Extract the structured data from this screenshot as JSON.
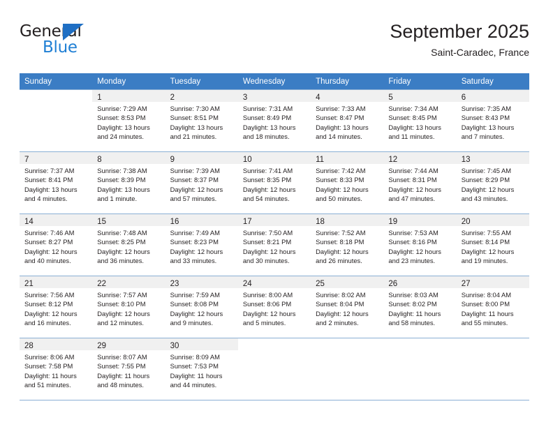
{
  "logo": {
    "word_top": "General",
    "word_bottom": "Blue",
    "color_dark": "#231f20",
    "color_blue": "#1f7fd4",
    "triangle_color": "#1f6fc4"
  },
  "header": {
    "title": "September 2025",
    "subtitle": "Saint-Caradec, France"
  },
  "colors": {
    "header_row_bg": "#3b7dc4",
    "header_row_text": "#ffffff",
    "daynum_bg": "#f0f0f0",
    "grid_line": "#8aafd4",
    "text": "#231f20"
  },
  "weekday_headers": [
    "Sunday",
    "Monday",
    "Tuesday",
    "Wednesday",
    "Thursday",
    "Friday",
    "Saturday"
  ],
  "weeks": [
    [
      {
        "day": "",
        "sunrise": "",
        "sunset": "",
        "daylight_1": "",
        "daylight_2": ""
      },
      {
        "day": "1",
        "sunrise": "Sunrise: 7:29 AM",
        "sunset": "Sunset: 8:53 PM",
        "daylight_1": "Daylight: 13 hours",
        "daylight_2": "and 24 minutes."
      },
      {
        "day": "2",
        "sunrise": "Sunrise: 7:30 AM",
        "sunset": "Sunset: 8:51 PM",
        "daylight_1": "Daylight: 13 hours",
        "daylight_2": "and 21 minutes."
      },
      {
        "day": "3",
        "sunrise": "Sunrise: 7:31 AM",
        "sunset": "Sunset: 8:49 PM",
        "daylight_1": "Daylight: 13 hours",
        "daylight_2": "and 18 minutes."
      },
      {
        "day": "4",
        "sunrise": "Sunrise: 7:33 AM",
        "sunset": "Sunset: 8:47 PM",
        "daylight_1": "Daylight: 13 hours",
        "daylight_2": "and 14 minutes."
      },
      {
        "day": "5",
        "sunrise": "Sunrise: 7:34 AM",
        "sunset": "Sunset: 8:45 PM",
        "daylight_1": "Daylight: 13 hours",
        "daylight_2": "and 11 minutes."
      },
      {
        "day": "6",
        "sunrise": "Sunrise: 7:35 AM",
        "sunset": "Sunset: 8:43 PM",
        "daylight_1": "Daylight: 13 hours",
        "daylight_2": "and 7 minutes."
      }
    ],
    [
      {
        "day": "7",
        "sunrise": "Sunrise: 7:37 AM",
        "sunset": "Sunset: 8:41 PM",
        "daylight_1": "Daylight: 13 hours",
        "daylight_2": "and 4 minutes."
      },
      {
        "day": "8",
        "sunrise": "Sunrise: 7:38 AM",
        "sunset": "Sunset: 8:39 PM",
        "daylight_1": "Daylight: 13 hours",
        "daylight_2": "and 1 minute."
      },
      {
        "day": "9",
        "sunrise": "Sunrise: 7:39 AM",
        "sunset": "Sunset: 8:37 PM",
        "daylight_1": "Daylight: 12 hours",
        "daylight_2": "and 57 minutes."
      },
      {
        "day": "10",
        "sunrise": "Sunrise: 7:41 AM",
        "sunset": "Sunset: 8:35 PM",
        "daylight_1": "Daylight: 12 hours",
        "daylight_2": "and 54 minutes."
      },
      {
        "day": "11",
        "sunrise": "Sunrise: 7:42 AM",
        "sunset": "Sunset: 8:33 PM",
        "daylight_1": "Daylight: 12 hours",
        "daylight_2": "and 50 minutes."
      },
      {
        "day": "12",
        "sunrise": "Sunrise: 7:44 AM",
        "sunset": "Sunset: 8:31 PM",
        "daylight_1": "Daylight: 12 hours",
        "daylight_2": "and 47 minutes."
      },
      {
        "day": "13",
        "sunrise": "Sunrise: 7:45 AM",
        "sunset": "Sunset: 8:29 PM",
        "daylight_1": "Daylight: 12 hours",
        "daylight_2": "and 43 minutes."
      }
    ],
    [
      {
        "day": "14",
        "sunrise": "Sunrise: 7:46 AM",
        "sunset": "Sunset: 8:27 PM",
        "daylight_1": "Daylight: 12 hours",
        "daylight_2": "and 40 minutes."
      },
      {
        "day": "15",
        "sunrise": "Sunrise: 7:48 AM",
        "sunset": "Sunset: 8:25 PM",
        "daylight_1": "Daylight: 12 hours",
        "daylight_2": "and 36 minutes."
      },
      {
        "day": "16",
        "sunrise": "Sunrise: 7:49 AM",
        "sunset": "Sunset: 8:23 PM",
        "daylight_1": "Daylight: 12 hours",
        "daylight_2": "and 33 minutes."
      },
      {
        "day": "17",
        "sunrise": "Sunrise: 7:50 AM",
        "sunset": "Sunset: 8:21 PM",
        "daylight_1": "Daylight: 12 hours",
        "daylight_2": "and 30 minutes."
      },
      {
        "day": "18",
        "sunrise": "Sunrise: 7:52 AM",
        "sunset": "Sunset: 8:18 PM",
        "daylight_1": "Daylight: 12 hours",
        "daylight_2": "and 26 minutes."
      },
      {
        "day": "19",
        "sunrise": "Sunrise: 7:53 AM",
        "sunset": "Sunset: 8:16 PM",
        "daylight_1": "Daylight: 12 hours",
        "daylight_2": "and 23 minutes."
      },
      {
        "day": "20",
        "sunrise": "Sunrise: 7:55 AM",
        "sunset": "Sunset: 8:14 PM",
        "daylight_1": "Daylight: 12 hours",
        "daylight_2": "and 19 minutes."
      }
    ],
    [
      {
        "day": "21",
        "sunrise": "Sunrise: 7:56 AM",
        "sunset": "Sunset: 8:12 PM",
        "daylight_1": "Daylight: 12 hours",
        "daylight_2": "and 16 minutes."
      },
      {
        "day": "22",
        "sunrise": "Sunrise: 7:57 AM",
        "sunset": "Sunset: 8:10 PM",
        "daylight_1": "Daylight: 12 hours",
        "daylight_2": "and 12 minutes."
      },
      {
        "day": "23",
        "sunrise": "Sunrise: 7:59 AM",
        "sunset": "Sunset: 8:08 PM",
        "daylight_1": "Daylight: 12 hours",
        "daylight_2": "and 9 minutes."
      },
      {
        "day": "24",
        "sunrise": "Sunrise: 8:00 AM",
        "sunset": "Sunset: 8:06 PM",
        "daylight_1": "Daylight: 12 hours",
        "daylight_2": "and 5 minutes."
      },
      {
        "day": "25",
        "sunrise": "Sunrise: 8:02 AM",
        "sunset": "Sunset: 8:04 PM",
        "daylight_1": "Daylight: 12 hours",
        "daylight_2": "and 2 minutes."
      },
      {
        "day": "26",
        "sunrise": "Sunrise: 8:03 AM",
        "sunset": "Sunset: 8:02 PM",
        "daylight_1": "Daylight: 11 hours",
        "daylight_2": "and 58 minutes."
      },
      {
        "day": "27",
        "sunrise": "Sunrise: 8:04 AM",
        "sunset": "Sunset: 8:00 PM",
        "daylight_1": "Daylight: 11 hours",
        "daylight_2": "and 55 minutes."
      }
    ],
    [
      {
        "day": "28",
        "sunrise": "Sunrise: 8:06 AM",
        "sunset": "Sunset: 7:58 PM",
        "daylight_1": "Daylight: 11 hours",
        "daylight_2": "and 51 minutes."
      },
      {
        "day": "29",
        "sunrise": "Sunrise: 8:07 AM",
        "sunset": "Sunset: 7:55 PM",
        "daylight_1": "Daylight: 11 hours",
        "daylight_2": "and 48 minutes."
      },
      {
        "day": "30",
        "sunrise": "Sunrise: 8:09 AM",
        "sunset": "Sunset: 7:53 PM",
        "daylight_1": "Daylight: 11 hours",
        "daylight_2": "and 44 minutes."
      },
      {
        "day": "",
        "sunrise": "",
        "sunset": "",
        "daylight_1": "",
        "daylight_2": ""
      },
      {
        "day": "",
        "sunrise": "",
        "sunset": "",
        "daylight_1": "",
        "daylight_2": ""
      },
      {
        "day": "",
        "sunrise": "",
        "sunset": "",
        "daylight_1": "",
        "daylight_2": ""
      },
      {
        "day": "",
        "sunrise": "",
        "sunset": "",
        "daylight_1": "",
        "daylight_2": ""
      }
    ]
  ]
}
